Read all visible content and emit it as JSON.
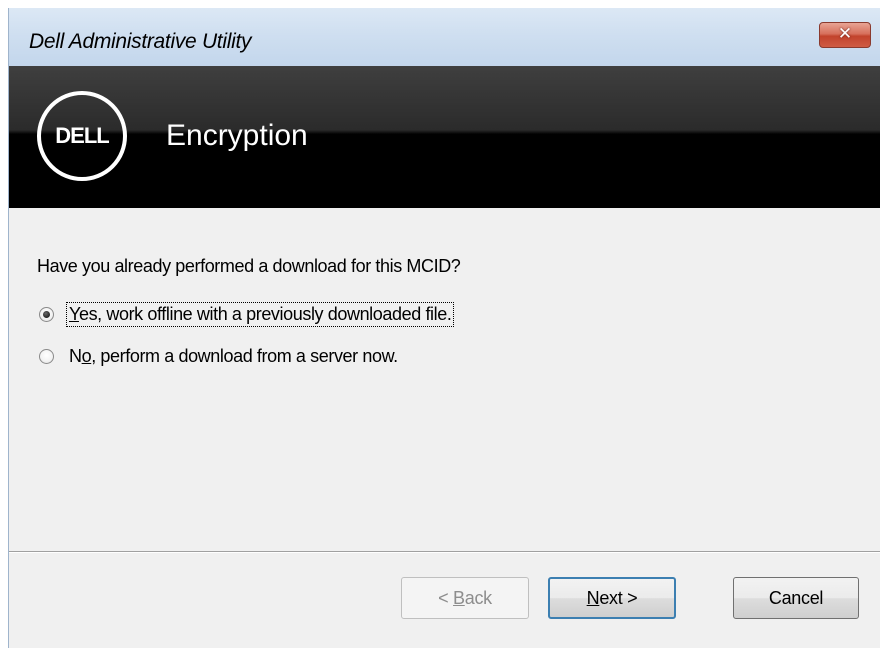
{
  "window": {
    "title": "Dell Administrative Utility",
    "close_icon": "close-icon",
    "close_glyph": "✕"
  },
  "banner": {
    "logo_text": "DELL",
    "title": "Encryption"
  },
  "content": {
    "question": "Have you already performed a download for this MCID?",
    "options": [
      {
        "label_prefix": "",
        "label_mnemonic": "Y",
        "label_suffix": "es, work offline with a previously downloaded file.",
        "selected": true
      },
      {
        "label_prefix": "N",
        "label_mnemonic": "o",
        "label_suffix": ", perform a download from a server now.",
        "selected": false
      }
    ]
  },
  "buttons": {
    "back": {
      "prefix": "< ",
      "mnemonic": "B",
      "suffix": "ack",
      "enabled": false
    },
    "next": {
      "mnemonic": "N",
      "suffix": "ext >",
      "enabled": true,
      "default": true
    },
    "cancel": {
      "label": "Cancel",
      "enabled": true
    }
  },
  "colors": {
    "dialog_bg": "#f0f0f0",
    "banner_bg": "#000000",
    "default_button_border": "#3c7fb1",
    "close_button": "#c2432c"
  }
}
